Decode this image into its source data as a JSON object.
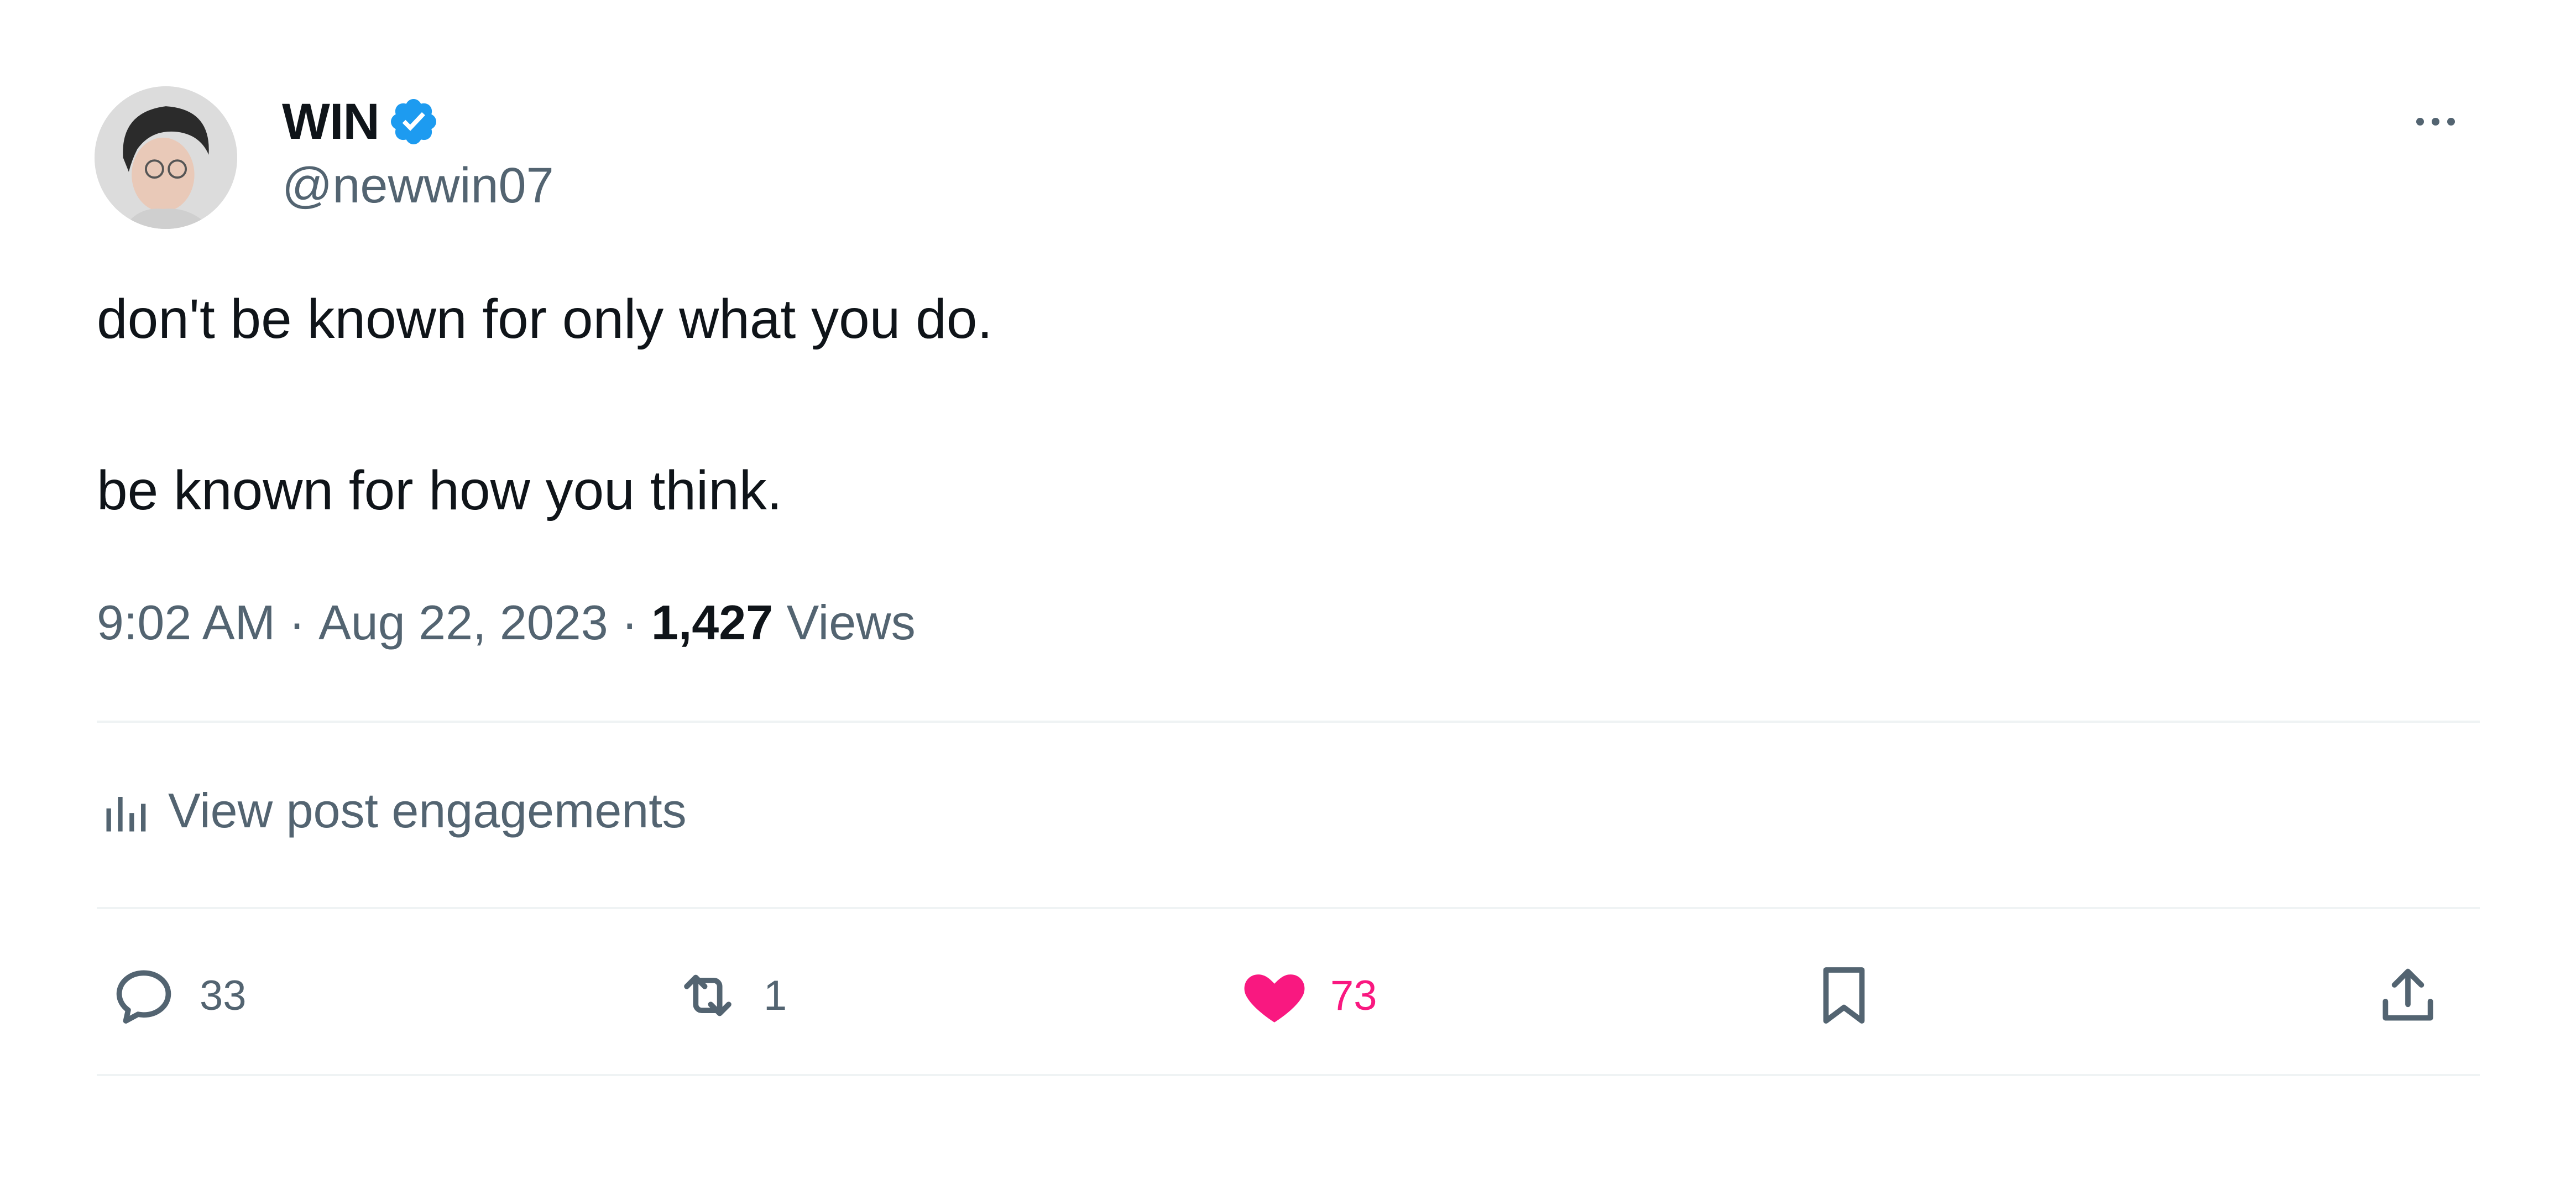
{
  "author": {
    "display_name": "WIN",
    "handle": "@newwin07",
    "verified": true,
    "avatar_icon": "profile-photo"
  },
  "post": {
    "line1": "don't be known for only what you do.",
    "line2": "be known for how you think.",
    "time": "9:02 AM",
    "separator": "·",
    "date": "Aug 22, 2023",
    "views_count": "1,427",
    "views_label": "Views"
  },
  "engagements": {
    "label": "View post engagements",
    "icon": "analytics-bars-icon"
  },
  "actions": {
    "reply_count": "33",
    "repost_count": "1",
    "like_count": "73",
    "liked": true
  },
  "colors": {
    "text_primary": "#0f1419",
    "text_secondary": "#536471",
    "verified_blue": "#1d9bf0",
    "like_pink": "#f91880",
    "divider": "#eff3f4"
  }
}
